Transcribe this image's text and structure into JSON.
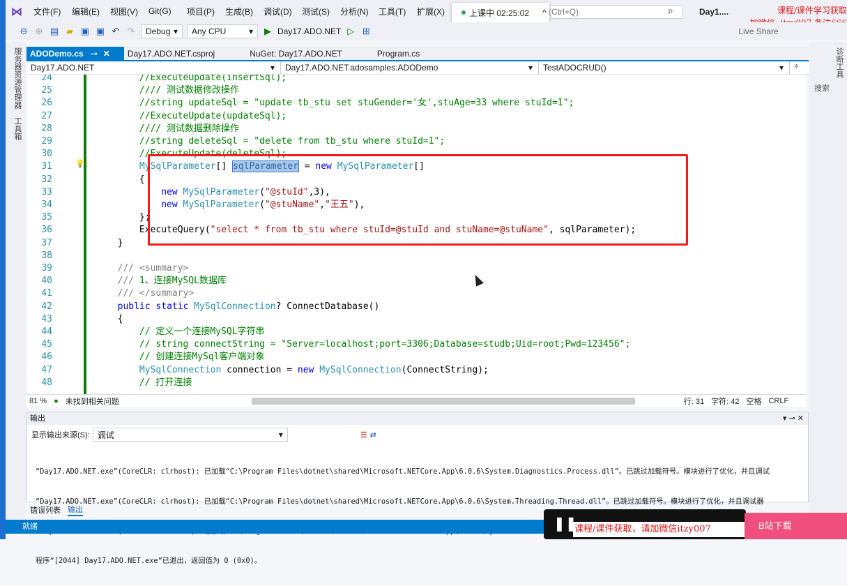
{
  "menu": [
    "文件(F)",
    "编辑(E)",
    "视图(V)",
    "Git(G)",
    "项目(P)",
    "生成(B)",
    "调试(D)",
    "测试(S)",
    "分析(N)",
    "工具(T)",
    "扩展(X)"
  ],
  "search_placeholder": "(Ctrl+Q)",
  "window_title": "Day1....",
  "class_status": "上课中 02:25:02",
  "watermark": [
    "课程/课件学习获取",
    "加微信: itzy007 备注666"
  ],
  "toolbar": {
    "config": "Debug",
    "platform": "Any CPU",
    "run_target": "Day17.ADO.NET",
    "live_share": "Live Share"
  },
  "left_dock": [
    "服务器资源管理器",
    "工具箱"
  ],
  "right_dock": [
    "诊断工具",
    "搜索"
  ],
  "tabs": [
    "ADODemo.cs",
    "Day17.ADO.NET.csproj",
    "NuGet: Day17.ADO.NET",
    "Program.cs"
  ],
  "nav": {
    "project": "Day17.ADO.NET",
    "class": "Day17.ADO.NET.adosamples.ADODemo",
    "member": "TestADOCRUD()"
  },
  "code": [
    {
      "n": "24",
      "t": [
        [
          "c",
          "            //ExecuteUpdate(insertSql);"
        ]
      ]
    },
    {
      "n": "25",
      "t": [
        [
          "c",
          "            //// 测试数据修改操作"
        ]
      ]
    },
    {
      "n": "26",
      "t": [
        [
          "c",
          "            //string updateSql = \"update tb_stu set stuGender='女',stuAge=33 where stuId=1\";"
        ]
      ]
    },
    {
      "n": "27",
      "t": [
        [
          "c",
          "            //ExecuteUpdate(updateSql);"
        ]
      ]
    },
    {
      "n": "28",
      "t": [
        [
          "c",
          "            //// 测试数据删除操作"
        ]
      ]
    },
    {
      "n": "29",
      "t": [
        [
          "c",
          "            //string deleteSql = \"delete from tb_stu where stuId=1\";"
        ]
      ]
    },
    {
      "n": "30",
      "t": [
        [
          "c",
          "            //ExecuteUpdate(deleteSql);"
        ]
      ]
    },
    {
      "n": "31",
      "t": [
        [
          "p",
          "            "
        ],
        [
          "t",
          "MySqlParameter"
        ],
        [
          "p",
          "[] "
        ],
        [
          "h",
          "sqlParameter"
        ],
        [
          "p",
          " = "
        ],
        [
          "k",
          "new"
        ],
        [
          "p",
          " "
        ],
        [
          "t",
          "MySqlParameter"
        ],
        [
          "p",
          "[]"
        ]
      ]
    },
    {
      "n": "32",
      "t": [
        [
          "p",
          "            {"
        ]
      ]
    },
    {
      "n": "33",
      "t": [
        [
          "p",
          "                "
        ],
        [
          "k",
          "new"
        ],
        [
          "p",
          " "
        ],
        [
          "t",
          "MySqlParameter"
        ],
        [
          "p",
          "("
        ],
        [
          "s",
          "\"@stuId\""
        ],
        [
          "p",
          ",3),"
        ]
      ]
    },
    {
      "n": "34",
      "t": [
        [
          "p",
          "                "
        ],
        [
          "k",
          "new"
        ],
        [
          "p",
          " "
        ],
        [
          "t",
          "MySqlParameter"
        ],
        [
          "p",
          "("
        ],
        [
          "s",
          "\"@stuName\""
        ],
        [
          "p",
          ","
        ],
        [
          "s",
          "\"王五\""
        ],
        [
          "p",
          "),"
        ]
      ]
    },
    {
      "n": "35",
      "t": [
        [
          "p",
          "            };"
        ]
      ]
    },
    {
      "n": "36",
      "t": [
        [
          "p",
          "            ExecuteQuery("
        ],
        [
          "s",
          "\"select * from tb_stu where stuId=@stuId and stuName=@stuName\""
        ],
        [
          "p",
          ", sqlParameter);"
        ]
      ]
    },
    {
      "n": "37",
      "t": [
        [
          "p",
          "        }"
        ]
      ]
    },
    {
      "n": "38",
      "t": [
        [
          "p",
          ""
        ]
      ]
    },
    {
      "n": "39",
      "t": [
        [
          "x",
          "        /// <summary>"
        ]
      ]
    },
    {
      "n": "40",
      "t": [
        [
          "x",
          "        ///"
        ],
        [
          "c",
          " 1、连接MySQL数据库"
        ]
      ]
    },
    {
      "n": "41",
      "t": [
        [
          "x",
          "        /// </summary>"
        ]
      ]
    },
    {
      "n": "42",
      "t": [
        [
          "p",
          "        "
        ],
        [
          "k",
          "public static"
        ],
        [
          "p",
          " "
        ],
        [
          "t",
          "MySqlConnection"
        ],
        [
          "p",
          "? ConnectDatabase()"
        ]
      ]
    },
    {
      "n": "43",
      "t": [
        [
          "p",
          "        {"
        ]
      ]
    },
    {
      "n": "44",
      "t": [
        [
          "c",
          "            // 定义一个连接MySQL字符串"
        ]
      ]
    },
    {
      "n": "45",
      "t": [
        [
          "c",
          "            // string connectString = \"Server=localhost;port=3306;Database=studb;Uid=root;Pwd=123456\";"
        ]
      ]
    },
    {
      "n": "46",
      "t": [
        [
          "c",
          "            // 创建连接MySql客户端对象"
        ]
      ]
    },
    {
      "n": "47",
      "t": [
        [
          "p",
          "            "
        ],
        [
          "t",
          "MySqlConnection"
        ],
        [
          "p",
          " connection = "
        ],
        [
          "k",
          "new"
        ],
        [
          "p",
          " "
        ],
        [
          "t",
          "MySqlConnection"
        ],
        [
          "p",
          "(ConnectString);"
        ]
      ]
    },
    {
      "n": "48",
      "t": [
        [
          "c",
          "            // 打开连接"
        ]
      ]
    }
  ],
  "editor_status": {
    "zoom": "81 %",
    "issues": "未找到相关问题",
    "line": "行: 31",
    "col": "字符: 42",
    "indent": "空格",
    "eol": "CRLF"
  },
  "output": {
    "title": "输出",
    "source_label": "显示输出来源(S):",
    "source_value": "调试",
    "lines": [
      "“Day17.ADO.NET.exe”(CoreCLR: clrhost): 已加载“C:\\Program Files\\dotnet\\shared\\Microsoft.NETCore.App\\6.0.6\\System.Diagnostics.Process.dll”。已跳过加载符号。模块进行了优化，并且调试",
      "“Day17.ADO.NET.exe”(CoreCLR: clrhost): 已加载“C:\\Program Files\\dotnet\\shared\\Microsoft.NETCore.App\\6.0.6\\System.Threading.Thread.dll”。已跳过加载符号。模块进行了优化，并且调试器",
      "“Day17.ADO.NET.exe”(CoreCLR: clrhost): 已加载“C:\\Program Files\\dotnet\\shared\\Microsoft.NETCore.App\\6.0.6\\System.Text.Encoding.CodePages.dll”。已跳过加载符号。模块进行了优化，并且",
      "程序“[2044] Day17.ADO.NET.exe”已退出，返回值为 0 (0x0)。"
    ]
  },
  "bottom_tabs": [
    "错误列表",
    "输出"
  ],
  "status": "就绪",
  "overlay": {
    "player_text": "课程/课件获取，请加微信itzy007",
    "pink_button": "B站下载"
  },
  "colors": {
    "accent": "#007acc",
    "annotation": "#ee1c1c"
  }
}
